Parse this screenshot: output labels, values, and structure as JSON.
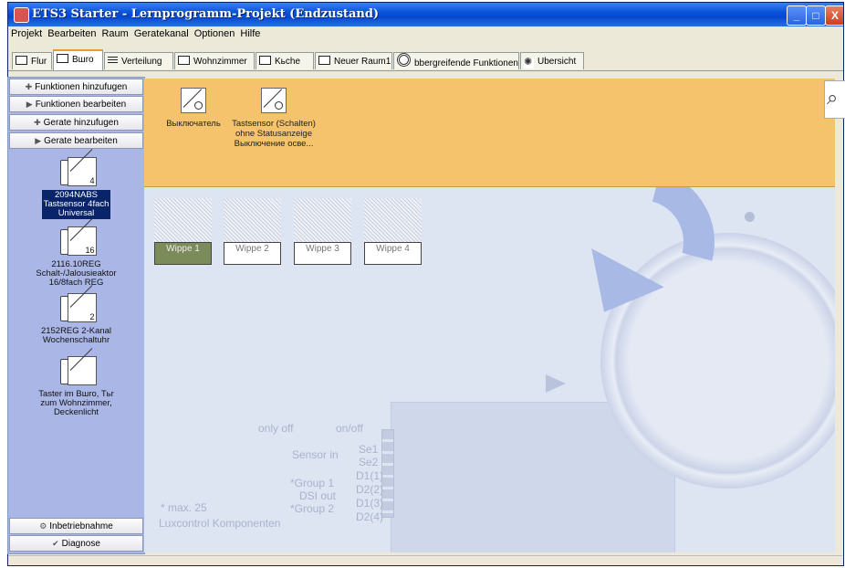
{
  "window": {
    "title": "ETS3 Starter - Lernprogramm-Projekt (Endzustand)",
    "minimize": "_",
    "maximize": "□",
    "close": "X"
  },
  "menu": [
    "Projekt",
    "Bearbeiten",
    "Raum",
    "Geratekanal",
    "Optionen",
    "Hilfe"
  ],
  "tabs": [
    {
      "label": "Flur",
      "icon": "room-icon"
    },
    {
      "label": "Bшro",
      "icon": "room-icon",
      "active": true
    },
    {
      "label": "Verteilung",
      "icon": "lines-icon"
    },
    {
      "label": "Wohnzimmer",
      "icon": "room-icon"
    },
    {
      "label": "Kьche",
      "icon": "room-icon"
    },
    {
      "label": "Neuer Raum1",
      "icon": "room-icon"
    },
    {
      "label": "bbergreifende Funktionen",
      "icon": "gear-icon"
    },
    {
      "label": "Ubersicht",
      "icon": "eye-icon"
    }
  ],
  "sidebar": {
    "buttons": [
      {
        "label": "Funktionen hinzufugen",
        "icon": "add-icon"
      },
      {
        "label": "Funktionen bearbeiten",
        "icon": "play-icon"
      },
      {
        "label": "Gerate hinzufugen",
        "icon": "add-icon"
      },
      {
        "label": "Gerate bearbeiten",
        "icon": "play-icon"
      }
    ],
    "devices": [
      {
        "number": "4",
        "line1": "2094NABS",
        "line2": "Tastsensor 4fach",
        "line3": "Universal",
        "selected": true
      },
      {
        "number": "16",
        "line1": "2116.10REG",
        "line2": "Schalt-/Jalousieaktor",
        "line3": "16/8fach REG"
      },
      {
        "number": "2",
        "line1": "2152REG 2-Kanal",
        "line2": "Wochenschaltuhr",
        "line3": ""
      },
      {
        "number": "",
        "line1": "Taster im Bшro, Tьr",
        "line2": "zum Wohnzimmer,",
        "line3": "Deckenlicht"
      }
    ],
    "bottom_buttons": [
      {
        "label": "Inbetriebnahme",
        "icon": "commissioning-icon"
      },
      {
        "label": "Diagnose",
        "icon": "check-icon"
      }
    ]
  },
  "functions": [
    {
      "line1": "Выключатель",
      "line2": "",
      "line3": ""
    },
    {
      "line1": "Tastsensor (Schalten)",
      "line2": "ohne Statusanzeige",
      "line3": "Выключение осве..."
    }
  ],
  "rockers": [
    {
      "label": "Wippe 1",
      "active": true
    },
    {
      "label": "Wippe 2"
    },
    {
      "label": "Wippe 3"
    },
    {
      "label": "Wippe 4"
    }
  ],
  "background_text": {
    "a": "only off",
    "b": "on/off",
    "c": "Sensor in",
    "d": "Se1",
    "e": "Se2",
    "f": "*Group 1",
    "g": "DSI out",
    "h": "*Group 2",
    "i": "D1(1)",
    "j": "D2(2)",
    "k": "D1(3)",
    "l": "D2(4)",
    "m": "* max. 25",
    "n": "Luxcontrol Komponenten"
  }
}
